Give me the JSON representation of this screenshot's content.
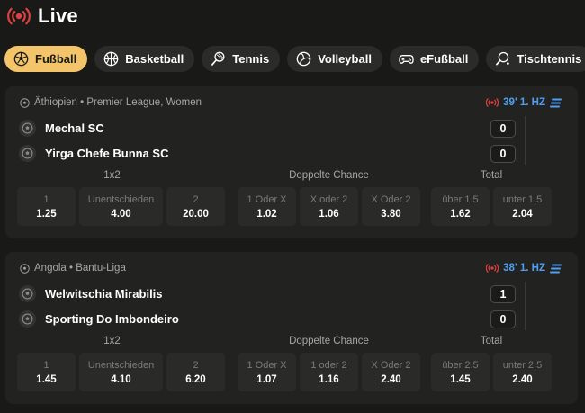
{
  "header": {
    "title": "Live",
    "live_icon": "broadcast-icon",
    "accent": "#e0403f"
  },
  "tabs": [
    {
      "label": "Fußball",
      "icon": "soccer-ball-icon",
      "active": true
    },
    {
      "label": "Basketball",
      "icon": "basketball-icon",
      "active": false
    },
    {
      "label": "Tennis",
      "icon": "tennis-racket-icon",
      "active": false
    },
    {
      "label": "Volleyball",
      "icon": "volleyball-icon",
      "active": false
    },
    {
      "label": "eFußball",
      "icon": "gamepad-icon",
      "active": false
    },
    {
      "label": "Tischtennis",
      "icon": "table-tennis-icon",
      "active": false
    }
  ],
  "colors": {
    "active_tab": "#f3c46a",
    "live_time": "#4f9ff2",
    "background": "#191917",
    "card": "#222220"
  },
  "matches": [
    {
      "league": "Äthiopien • Premier League, Women",
      "time": "39' 1. HZ",
      "teams": [
        {
          "name": "Mechal SC",
          "score": "0"
        },
        {
          "name": "Yirga Chefe Bunna SC",
          "score": "0"
        }
      ],
      "markets": [
        {
          "title": "1x2",
          "odds": [
            {
              "label": "1",
              "value": "1.25"
            },
            {
              "label": "Unentschieden",
              "value": "4.00"
            },
            {
              "label": "2",
              "value": "20.00"
            }
          ]
        },
        {
          "title": "Doppelte Chance",
          "odds": [
            {
              "label": "1 Oder X",
              "value": "1.02"
            },
            {
              "label": "X oder 2",
              "value": "1.06"
            },
            {
              "label": "X Oder 2",
              "value": "3.80"
            }
          ]
        },
        {
          "title": "Total",
          "odds": [
            {
              "label": "über 1.5",
              "value": "1.62"
            },
            {
              "label": "unter 1.5",
              "value": "2.04"
            }
          ]
        }
      ]
    },
    {
      "league": "Angola • Bantu-Liga",
      "time": "38' 1. HZ",
      "teams": [
        {
          "name": "Welwitschia Mirabilis",
          "score": "1"
        },
        {
          "name": "Sporting Do Imbondeiro",
          "score": "0"
        }
      ],
      "markets": [
        {
          "title": "1x2",
          "odds": [
            {
              "label": "1",
              "value": "1.45"
            },
            {
              "label": "Unentschieden",
              "value": "4.10"
            },
            {
              "label": "2",
              "value": "6.20"
            }
          ]
        },
        {
          "title": "Doppelte Chance",
          "odds": [
            {
              "label": "1 Oder X",
              "value": "1.07"
            },
            {
              "label": "1 oder 2",
              "value": "1.16"
            },
            {
              "label": "X Oder 2",
              "value": "2.40"
            }
          ]
        },
        {
          "title": "Total",
          "odds": [
            {
              "label": "über 2.5",
              "value": "1.45"
            },
            {
              "label": "unter 2.5",
              "value": "2.40"
            }
          ]
        }
      ]
    }
  ]
}
